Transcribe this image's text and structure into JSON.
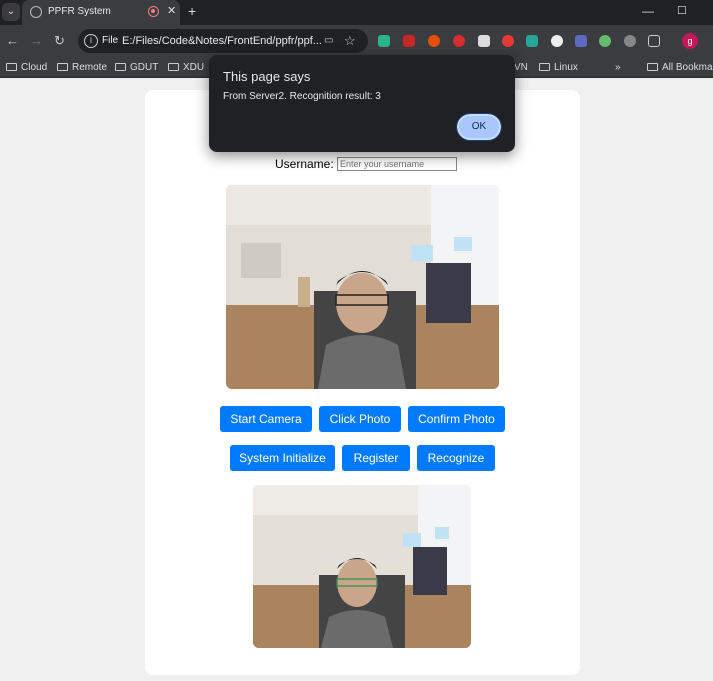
{
  "browser": {
    "tab_title": "PPFR System",
    "tab_close": "✕",
    "new_tab": "+",
    "omnibox_scheme": "File",
    "omnibox_url": "E:/Files/Code&Notes/FrontEnd/ppfr/ppf...",
    "profile_initial": "g",
    "bookmarks": [
      "Cloud",
      "Remote",
      "GDUT",
      "XDU",
      "VN",
      "Linux"
    ],
    "bookmarks_more": "»",
    "all_bookmarks": "All Bookmarks"
  },
  "dialog": {
    "title": "This page says",
    "message": "From Server2. Recognition result: 3",
    "ok_label": "OK"
  },
  "form": {
    "username_label": "Username:",
    "username_placeholder": "Enter your username",
    "username_value": ""
  },
  "buttons": {
    "start_camera": "Start Camera",
    "click_photo": "Click Photo",
    "confirm_photo": "Confirm Photo",
    "system_initialize": "System Initialize",
    "register": "Register",
    "recognize": "Recognize"
  },
  "colors": {
    "primary_button": "#007bff",
    "dialog_bg": "#202124",
    "ok_button": "#a8c7fa"
  },
  "icons": {
    "video_stream": "live-camera-feed",
    "captured_photo": "captured-photo"
  }
}
